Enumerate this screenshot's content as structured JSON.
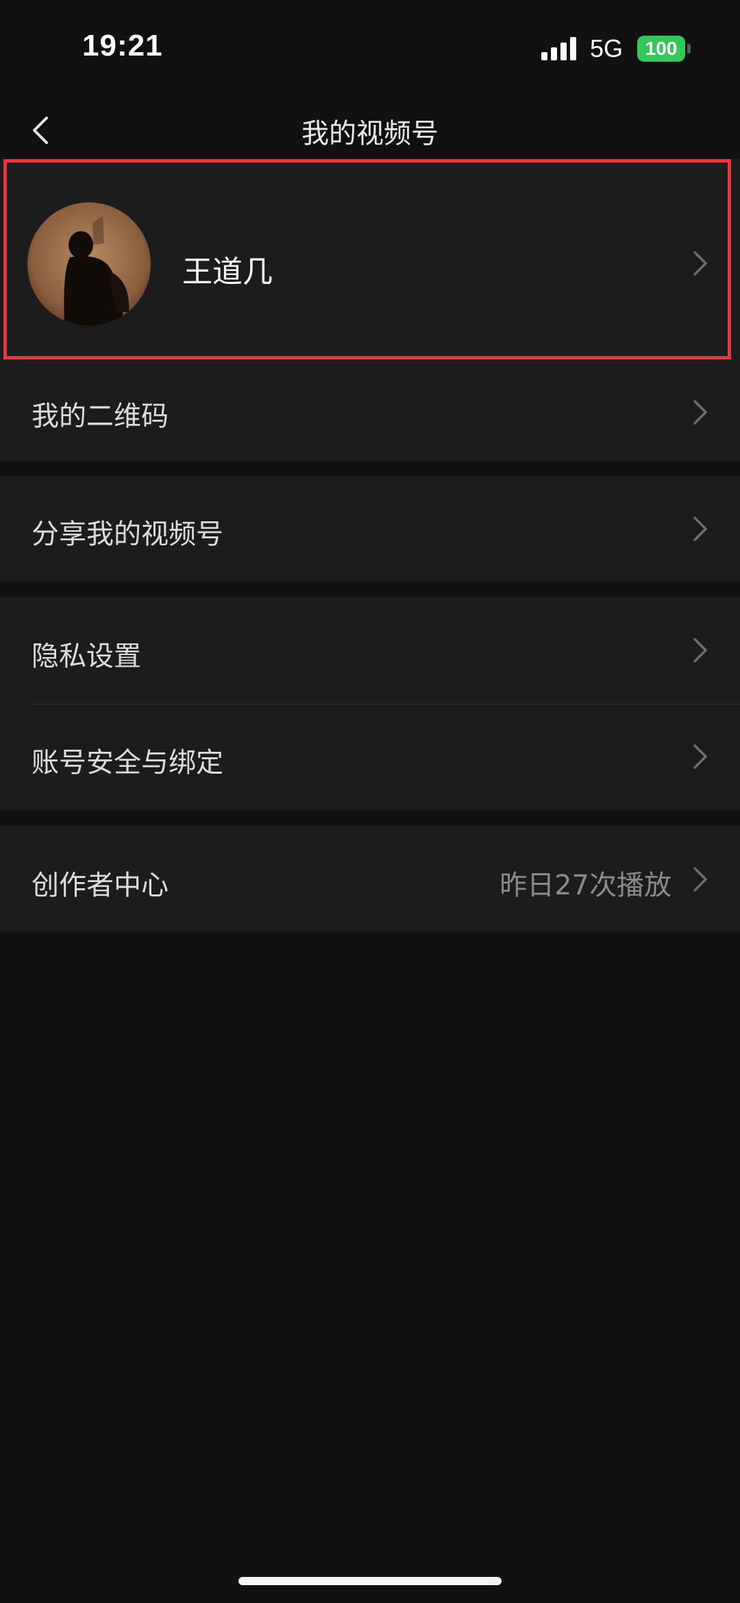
{
  "status_bar": {
    "time": "19:21",
    "network": "5G",
    "battery": "100",
    "signal_icon": "signal-bars-icon",
    "battery_icon": "battery-icon"
  },
  "nav": {
    "title": "我的视频号",
    "back_icon": "chevron-left-icon"
  },
  "profile": {
    "name": "王道几",
    "avatar_icon": "avatar-silhouette",
    "highlight_color": "#e5393e"
  },
  "menu": {
    "qr_code": "我的二维码",
    "share": "分享我的视频号",
    "privacy": "隐私设置",
    "account_security": "账号安全与绑定",
    "creator_center": "创作者中心",
    "creator_center_stats": "昨日27次播放"
  },
  "theme": {
    "background": "#111111",
    "row_background": "#1c1c1c",
    "accent_battery": "#34c759"
  }
}
